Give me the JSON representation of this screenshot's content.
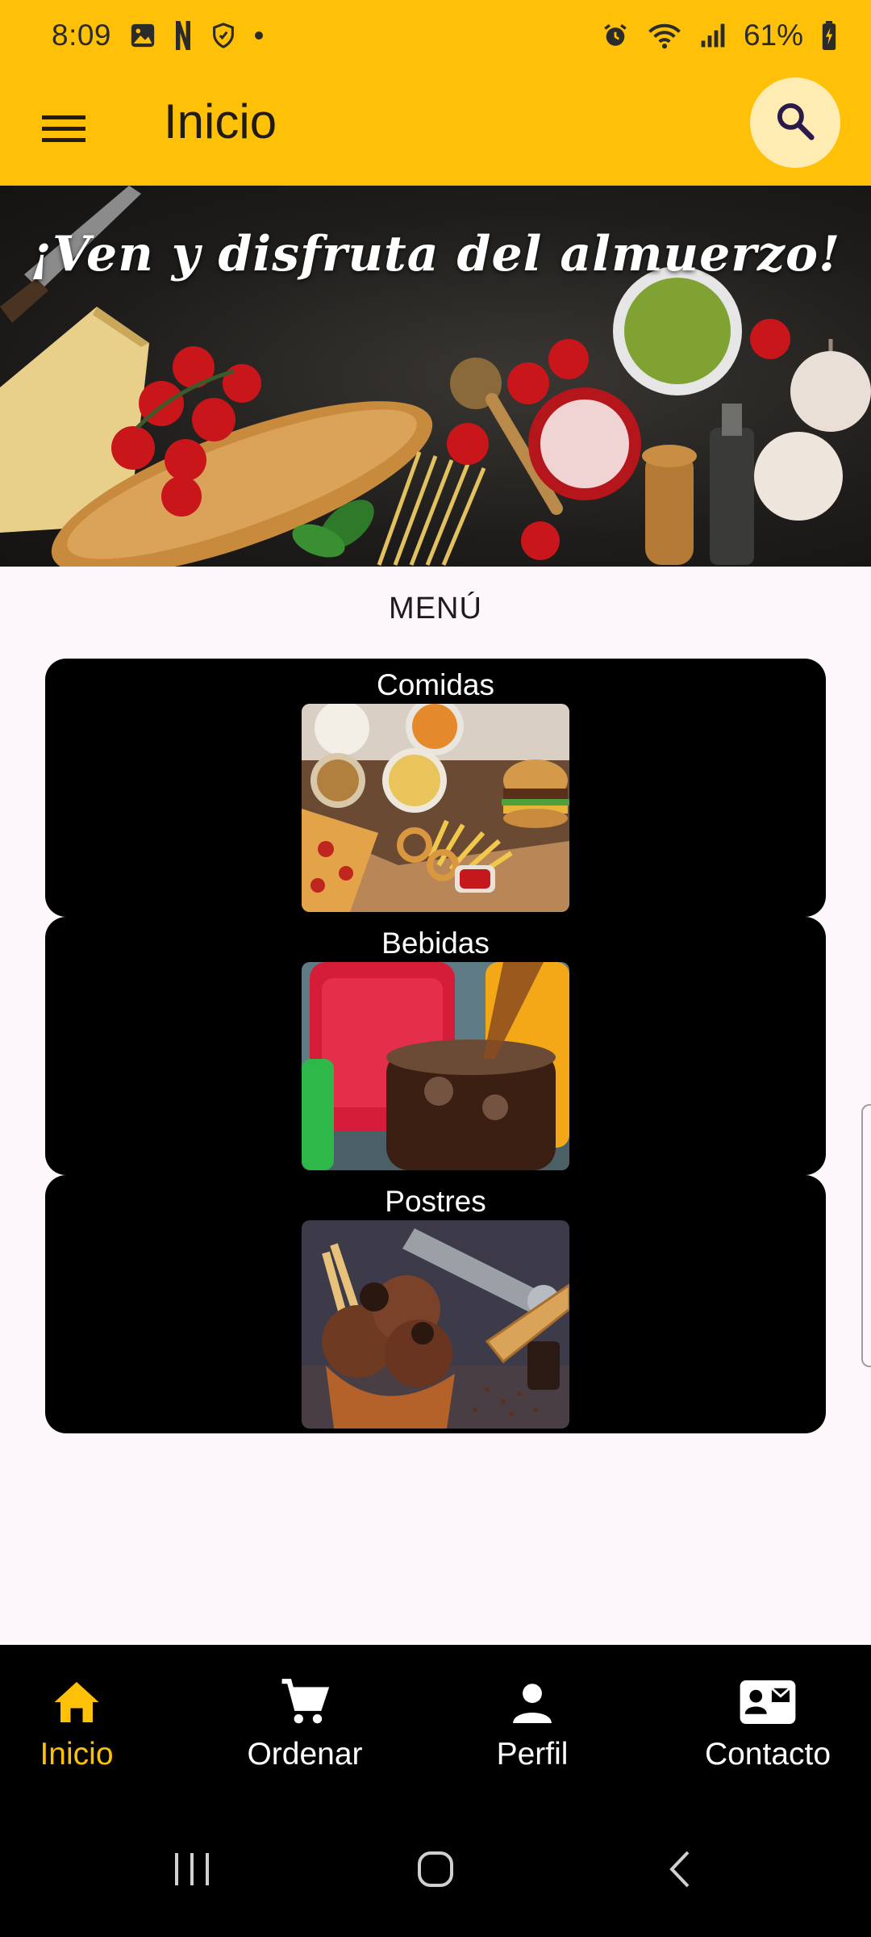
{
  "status_bar": {
    "time": "8:09",
    "battery": "61%",
    "left_icons": [
      "gallery-icon",
      "netflix-icon",
      "hand-shield-icon",
      "dot-icon"
    ],
    "right_icons": [
      "alarm-icon",
      "wifi-icon",
      "signal-icon",
      "battery-charging-icon"
    ]
  },
  "app_bar": {
    "title": "Inicio",
    "menu_icon": "hamburger-menu-icon",
    "search_icon": "search-icon"
  },
  "banner": {
    "title": "¡Ven y disfruta del almuerzo!"
  },
  "menu": {
    "heading": "MENÚ",
    "items": [
      {
        "label": "Comidas"
      },
      {
        "label": "Bebidas"
      },
      {
        "label": "Postres"
      }
    ]
  },
  "bottom_nav": {
    "items": [
      {
        "label": "Inicio",
        "icon": "home-icon",
        "active": true
      },
      {
        "label": "Ordenar",
        "icon": "cart-icon",
        "active": false
      },
      {
        "label": "Perfil",
        "icon": "person-icon",
        "active": false
      },
      {
        "label": "Contacto",
        "icon": "contact-card-icon",
        "active": false
      }
    ]
  },
  "system_nav": {
    "items": [
      "recents-icon",
      "home-circle-icon",
      "back-icon"
    ]
  },
  "colors": {
    "accent": "#ffc107",
    "accent_light": "#ffecb3",
    "background": "#fdf7fc",
    "card": "#000000",
    "nav_bg": "#000000"
  }
}
